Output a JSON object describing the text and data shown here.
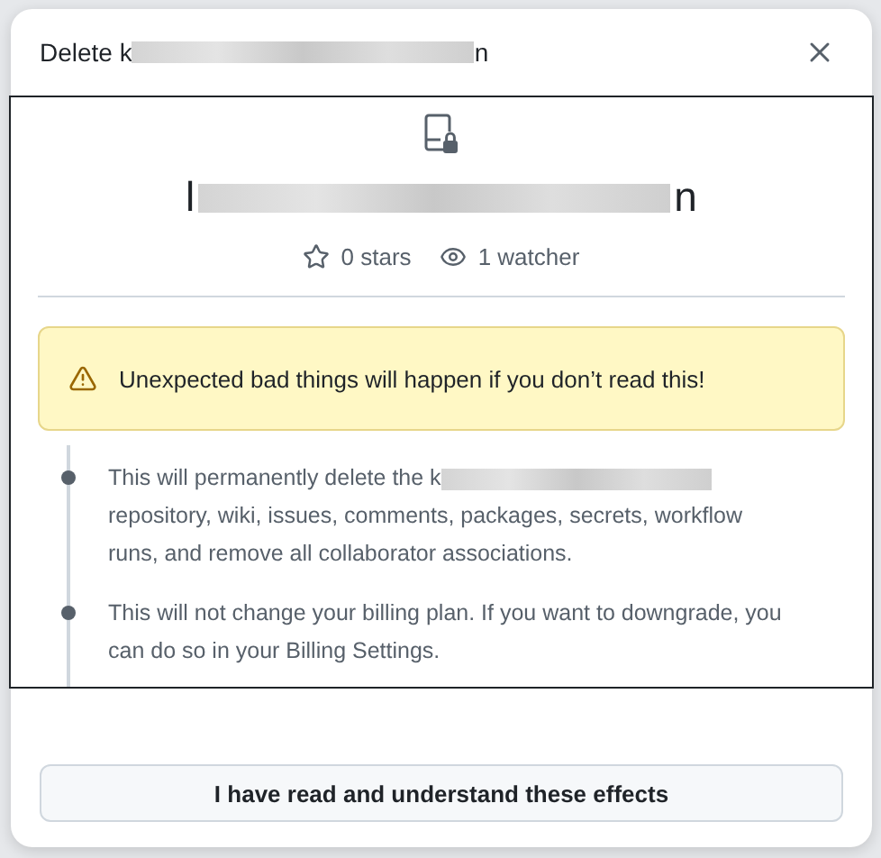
{
  "dialog": {
    "title": "Delete k",
    "title_tail": "n"
  },
  "repository": {
    "name_start": "l",
    "name_end": "n",
    "stars": "0 stars",
    "watchers": "1 watcher"
  },
  "warning": {
    "text": "Unexpected bad things will happen if you don’t read this!"
  },
  "effects": [
    {
      "text": "This will permanently delete the k",
      "redacted": true,
      "rest": "repository, wiki, issues, comments, packages, secrets, workflow runs, and remove all collaborator associations."
    },
    {
      "text": "This will not change your billing plan. If you want to downgrade, you can do so in your Billing Settings.",
      "redacted": false
    }
  ],
  "confirm_button": {
    "label": "I have read and understand these effects"
  }
}
